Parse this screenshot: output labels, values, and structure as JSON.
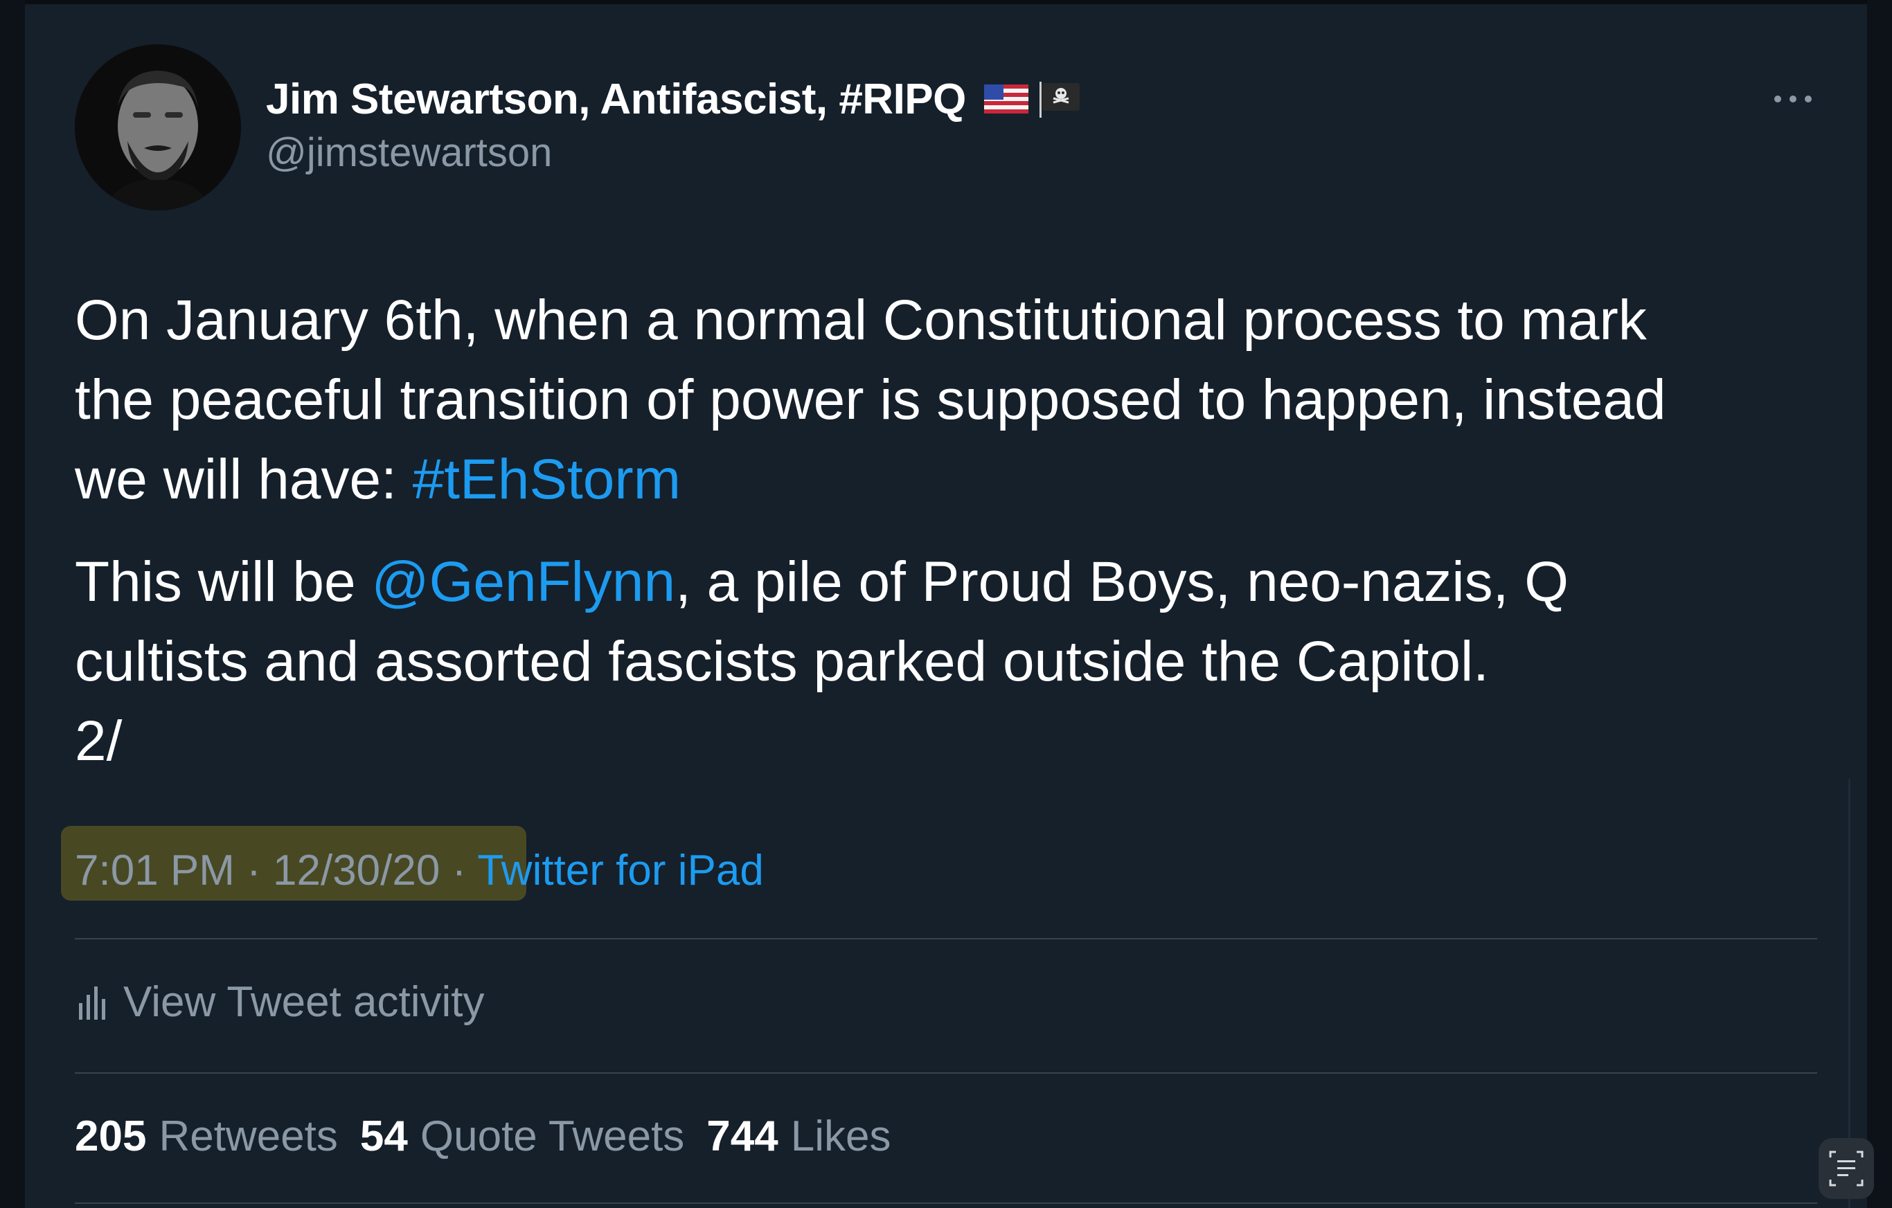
{
  "author": {
    "display_name": "Jim Stewartson, Antifascist, #RIPQ",
    "handle": "@jimstewartson",
    "name_emojis": [
      "us-flag-icon",
      "pirate-flag-icon"
    ]
  },
  "tweet": {
    "para1": {
      "text_before": "On January 6th, when a normal Constitutional process to mark",
      "line2": "the peaceful transition of power is supposed to happen, instead",
      "line3_prefix": "we will have: ",
      "hashtag": "#tEhStorm"
    },
    "para2": {
      "prefix": "This will be ",
      "mention": "@GenFlynn",
      "suffix": ", a pile of Proud Boys, neo-nazis, Q",
      "line2": "cultists and assorted fascists parked outside the Capitol.",
      "line3": "2/"
    }
  },
  "meta": {
    "time": "7:01 PM",
    "separator": " · ",
    "date": "12/30/20",
    "client": "Twitter for iPad"
  },
  "activity": {
    "label": "View Tweet activity"
  },
  "stats": {
    "retweets": "205",
    "retweets_label": "Retweets",
    "quote_tweets": "54",
    "quote_tweets_label": "Quote Tweets",
    "likes": "744",
    "likes_label": "Likes"
  },
  "colors": {
    "background": "#15202b",
    "text_primary": "#ffffff",
    "text_secondary": "#8b98a5",
    "link": "#1d9bf0",
    "divider": "#38444d",
    "highlight": "#4e4e22"
  }
}
